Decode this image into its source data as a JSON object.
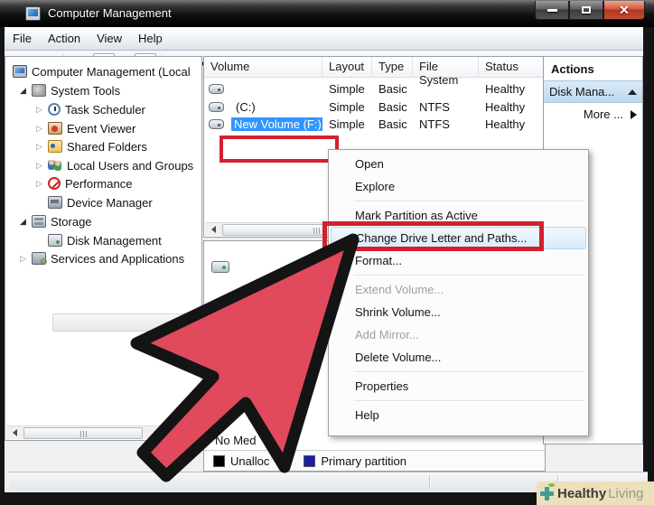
{
  "window": {
    "title": "Computer Management"
  },
  "menubar": {
    "items": [
      "File",
      "Action",
      "View",
      "Help"
    ]
  },
  "toolbar": {
    "icons": [
      "back-icon",
      "forward-icon",
      "up-one-level-icon",
      "show-console-tree-icon",
      "help-icon",
      "show-actions-pane-icon",
      "refresh-icon",
      "delete-icon",
      "properties-icon",
      "open-icon",
      "find-icon",
      "help-window-icon"
    ]
  },
  "tree": {
    "items": [
      {
        "label": "Computer Management (Local",
        "selected": false
      },
      {
        "label": "System Tools",
        "selected": false
      },
      {
        "label": "Task Scheduler",
        "selected": false
      },
      {
        "label": "Event Viewer",
        "selected": false
      },
      {
        "label": "Shared Folders",
        "selected": false
      },
      {
        "label": "Local Users and Groups",
        "selected": false
      },
      {
        "label": "Performance",
        "selected": false
      },
      {
        "label": "Device Manager",
        "selected": false
      },
      {
        "label": "Storage",
        "selected": false
      },
      {
        "label": "Disk Management",
        "selected": true
      },
      {
        "label": "Services and Applications",
        "selected": false
      }
    ]
  },
  "volume_table": {
    "headers": [
      "Volume",
      "Layout",
      "Type",
      "File System",
      "Status"
    ],
    "rows": [
      {
        "volume": "",
        "layout": "Simple",
        "type": "Basic",
        "fs": "",
        "status": "Healthy"
      },
      {
        "volume": "(C:)",
        "layout": "Simple",
        "type": "Basic",
        "fs": "NTFS",
        "status": "Healthy"
      },
      {
        "volume": "New Volume (F:)",
        "layout": "Simple",
        "type": "Basic",
        "fs": "NTFS",
        "status": "Healthy"
      }
    ]
  },
  "context_menu": {
    "items": [
      {
        "label": "Open",
        "state": "normal"
      },
      {
        "label": "Explore",
        "state": "normal"
      },
      {
        "label": "Mark Partition as Active",
        "state": "normal"
      },
      {
        "label": "Change Drive Letter and Paths...",
        "state": "highlighted"
      },
      {
        "label": "Format...",
        "state": "normal"
      },
      {
        "label": "Extend Volume...",
        "state": "disabled"
      },
      {
        "label": "Shrink Volume...",
        "state": "normal"
      },
      {
        "label": "Add Mirror...",
        "state": "disabled"
      },
      {
        "label": "Delete Volume...",
        "state": "normal"
      },
      {
        "label": "Properties",
        "state": "normal"
      },
      {
        "label": "Help",
        "state": "normal"
      }
    ]
  },
  "actions_panel": {
    "header": "Actions",
    "item": "Disk Mana...",
    "more": "More ..."
  },
  "disk_view": {
    "no_media": "No Med"
  },
  "legend": {
    "items": [
      {
        "label": "Unalloc",
        "color": "#000000"
      },
      {
        "label": "Primary partition",
        "color": "#1c1caa"
      }
    ]
  },
  "watermark": {
    "bold": "Healthy",
    "light": "Living"
  },
  "colors": {
    "selection_blue": "#3096ff",
    "annotation_red": "#d32030",
    "arrow_fill": "#e04a5c",
    "arrow_outline": "#141414",
    "close_button_red": "#c34f31",
    "menu_highlight": "#d8eafa"
  }
}
